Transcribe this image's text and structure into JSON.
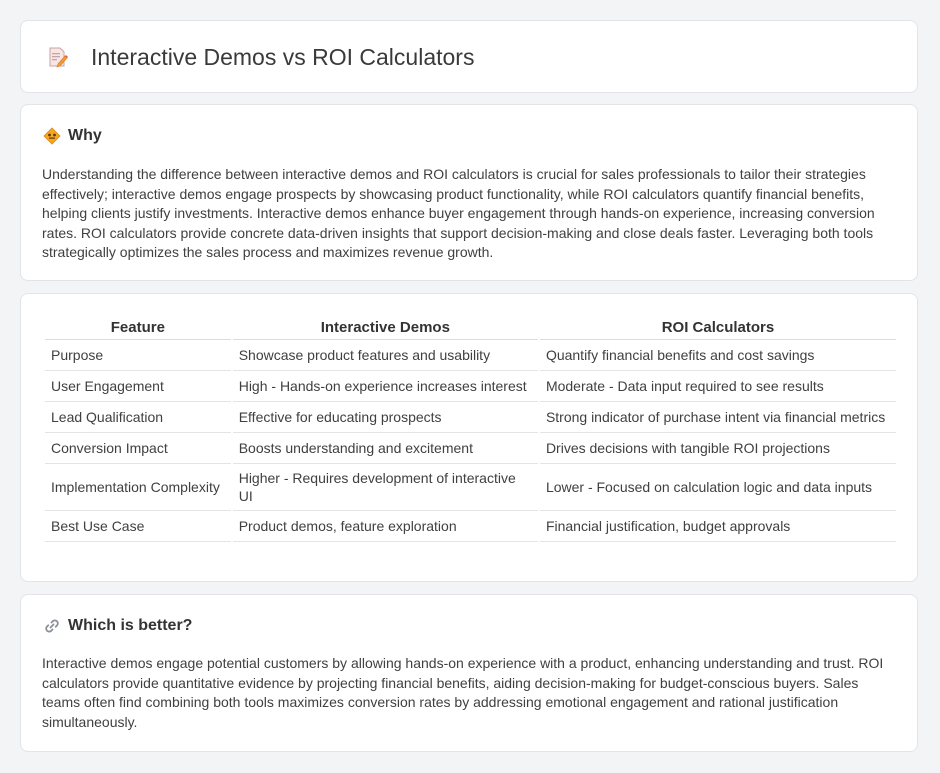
{
  "header": {
    "title": "Interactive Demos vs ROI Calculators",
    "icon": "document-pencil-icon"
  },
  "why": {
    "title": "Why",
    "icon": "diamond-sign-icon",
    "text": "Understanding the difference between interactive demos and ROI calculators is crucial for sales professionals to tailor their strategies effectively; interactive demos engage prospects by showcasing product functionality, while ROI calculators quantify financial benefits, helping clients justify investments. Interactive demos enhance buyer engagement through hands-on experience, increasing conversion rates. ROI calculators provide concrete data-driven insights that support decision-making and close deals faster. Leveraging both tools strategically optimizes the sales process and maximizes revenue growth."
  },
  "table": {
    "headers": [
      "Feature",
      "Interactive Demos",
      "ROI Calculators"
    ],
    "rows": [
      [
        "Purpose",
        "Showcase product features and usability",
        "Quantify financial benefits and cost savings"
      ],
      [
        "User Engagement",
        "High - Hands-on experience increases interest",
        "Moderate - Data input required to see results"
      ],
      [
        "Lead Qualification",
        "Effective for educating prospects",
        "Strong indicator of purchase intent via financial metrics"
      ],
      [
        "Conversion Impact",
        "Boosts understanding and excitement",
        "Drives decisions with tangible ROI projections"
      ],
      [
        "Implementation Complexity",
        "Higher - Requires development of interactive UI",
        "Lower - Focused on calculation logic and data inputs"
      ],
      [
        "Best Use Case",
        "Product demos, feature exploration",
        "Financial justification, budget approvals"
      ]
    ]
  },
  "better": {
    "title": "Which is better?",
    "icon": "link-icon",
    "text": "Interactive demos engage potential customers by allowing hands-on experience with a product, enhancing understanding and trust. ROI calculators provide quantitative evidence by projecting financial benefits, aiding decision-making for budget-conscious buyers. Sales teams often find combining both tools maximizes conversion rates by addressing emotional engagement and rational justification simultaneously."
  },
  "colors": {
    "background": "#f3f4f6",
    "card": "#ffffff",
    "accent_orange": "#f5a623",
    "border": "#e2e4e8"
  }
}
